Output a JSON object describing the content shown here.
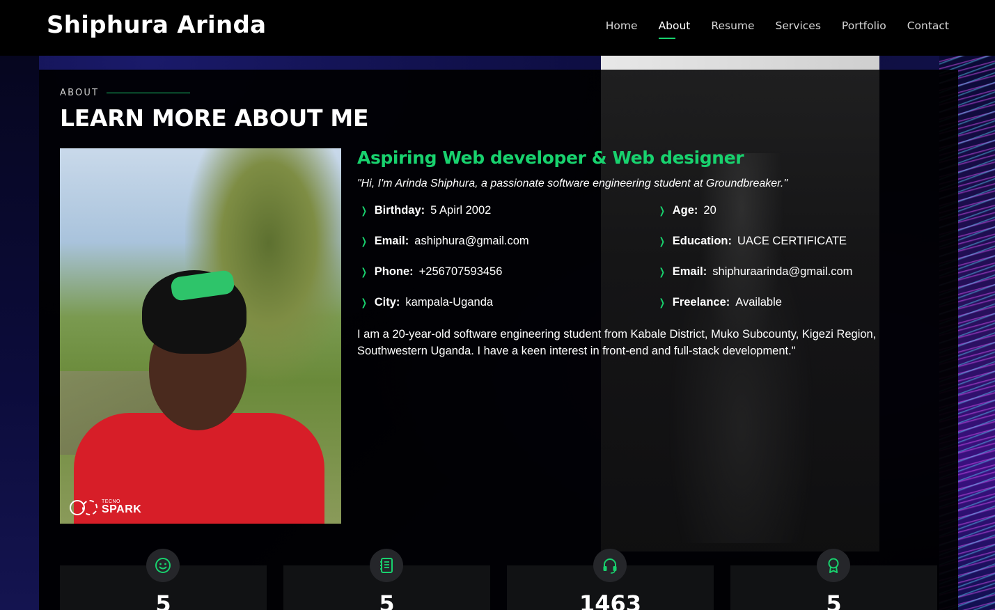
{
  "header": {
    "logo": "Shiphura Arinda",
    "nav": [
      "Home",
      "About",
      "Resume",
      "Services",
      "Portfolio",
      "Contact"
    ],
    "active": "About"
  },
  "about": {
    "label": "ABOUT",
    "title": "LEARN MORE ABOUT ME",
    "role": "Aspiring Web developer & Web designer",
    "quote": "\"Hi, I'm Arinda Shiphura, a passionate software engineering student at Groundbreaker.\"",
    "facts_left": [
      {
        "k": "Birthday:",
        "v": "5 Apirl 2002"
      },
      {
        "k": "Email:",
        "v": "ashiphura@gmail.com"
      },
      {
        "k": "Phone:",
        "v": "+256707593456"
      },
      {
        "k": "City:",
        "v": "kampala-Uganda"
      }
    ],
    "facts_right": [
      {
        "k": "Age:",
        "v": "20"
      },
      {
        "k": "Education:",
        "v": "UACE CERTIFICATE"
      },
      {
        "k": "Email:",
        "v": "shiphuraarinda@gmail.com"
      },
      {
        "k": "Freelance:",
        "v": "Available"
      }
    ],
    "bio": "I am a 20-year-old software engineering student from Kabale District, Muko Subcounty, Kigezi Region, Southwestern Uganda. I have a keen interest in front-end and full-stack development.\"",
    "photo_watermark": {
      "small": "TECNO",
      "large": "SPARK"
    }
  },
  "stats": [
    {
      "icon": "smiley-icon",
      "value": "5"
    },
    {
      "icon": "journal-icon",
      "value": "5"
    },
    {
      "icon": "headset-icon",
      "value": "1463"
    },
    {
      "icon": "award-icon",
      "value": "5"
    }
  ],
  "colors": {
    "accent": "#18d26e",
    "header_bg": "#000000",
    "panel_bg": "#000000"
  }
}
